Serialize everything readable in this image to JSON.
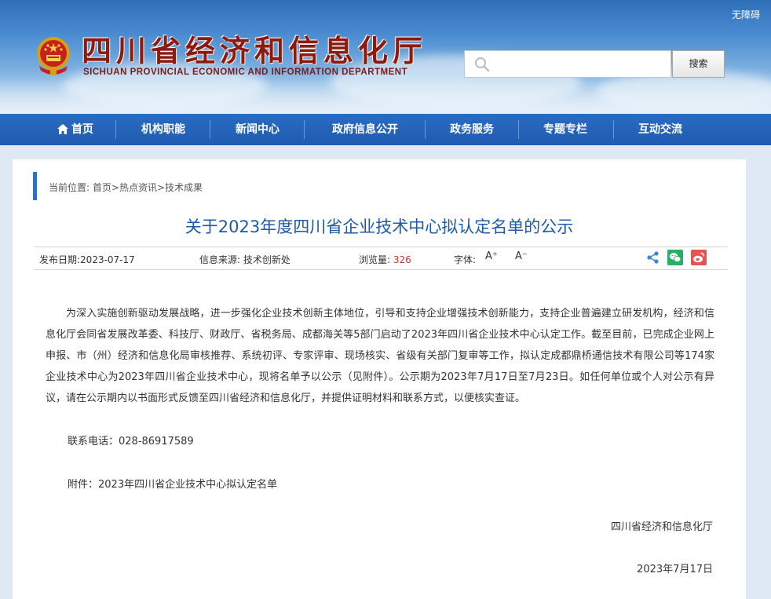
{
  "header": {
    "accessibility": "无障碍",
    "title": "四川省经济和信息化厅",
    "subtitle": "SICHUAN PROVINCIAL ECONOMIC AND INFORMATION DEPARTMENT",
    "search_placeholder": "",
    "search_button": "搜索"
  },
  "nav": {
    "items": [
      {
        "label": "首页"
      },
      {
        "label": "机构职能"
      },
      {
        "label": "新闻中心"
      },
      {
        "label": "政府信息公开"
      },
      {
        "label": "政务服务"
      },
      {
        "label": "专题专栏"
      },
      {
        "label": "互动交流"
      }
    ]
  },
  "breadcrumb": {
    "prefix": "当前位置:",
    "items": [
      "首页",
      "热点资讯",
      "技术成果"
    ],
    "sep": ">"
  },
  "article": {
    "title": "关于2023年度四川省企业技术中心拟认定名单的公示",
    "publish_date": "发布日期:2023-07-17",
    "source": "信息来源:  技术创新处",
    "views_label": "浏览量:",
    "views_count": "326",
    "font_label": "字体:",
    "font_increase": "A⁺",
    "font_decrease": "A⁻",
    "body": "为深入实施创新驱动发展战略，进一步强化企业技术创新主体地位，引导和支持企业增强技术创新能力，支持企业普遍建立研发机构，经济和信息化厅会同省发展改革委、科技厅、财政厅、省税务局、成都海关等5部门启动了2023年四川省企业技术中心认定工作。截至目前，已完成企业网上申报、市（州）经济和信息化局审核推荐、系统初评、专家评审、现场核实、省级有关部门复审等工作，拟认定成都鼎桥通信技术有限公司等174家企业技术中心为2023年四川省企业技术中心，现将名单予以公示（见附件）。公示期为2023年7月17日至7月23日。如任何单位或个人对公示有异议，请在公示期内以书面形式反馈至四川省经济和信息化厅，并提供证明材料和联系方式，以便核实查证。",
    "contact": "联系电话：028-86917589",
    "attachment": "附件：2023年四川省企业技术中心拟认定名单",
    "signature": "四川省经济和信息化厅",
    "date": "2023年7月17日"
  },
  "colors": {
    "nav_bg": "#1f5cb0",
    "title_blue": "#1e5aa8",
    "accent_red": "#c0392b",
    "wechat_green": "#2aae67",
    "weibo_red": "#e8534f"
  }
}
